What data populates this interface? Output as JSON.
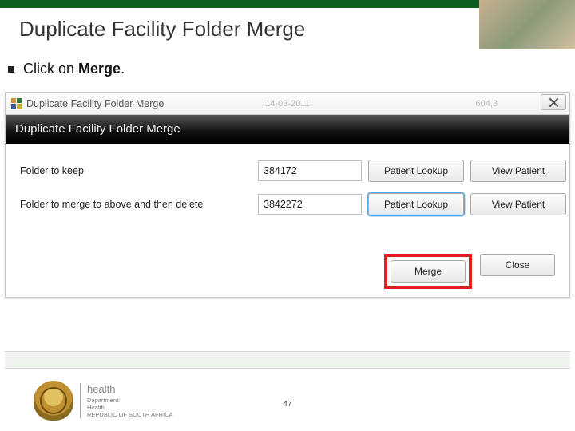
{
  "slide": {
    "title": "Duplicate Facility Folder Merge",
    "instruction_prefix": "Click on ",
    "instruction_bold": "Merge",
    "instruction_suffix": "."
  },
  "window": {
    "title": "Duplicate Facility Folder Merge",
    "bg_date": "14-03-2011",
    "bg_num": "604,3",
    "close_label": "X"
  },
  "dialog": {
    "banner": "Duplicate Facility Folder Merge",
    "rows": [
      {
        "label": "Folder to keep",
        "value": "384172",
        "lookup": "Patient Lookup",
        "view": "View Patient"
      },
      {
        "label": "Folder to merge to above and then delete",
        "value": "3842272",
        "lookup": "Patient Lookup",
        "view": "View Patient"
      }
    ],
    "merge_btn": "Merge",
    "close_btn": "Close"
  },
  "footer": {
    "dept": "health",
    "line1": "Department:",
    "line2": "Health",
    "line3": "REPUBLIC OF SOUTH AFRICA",
    "page": "47"
  }
}
